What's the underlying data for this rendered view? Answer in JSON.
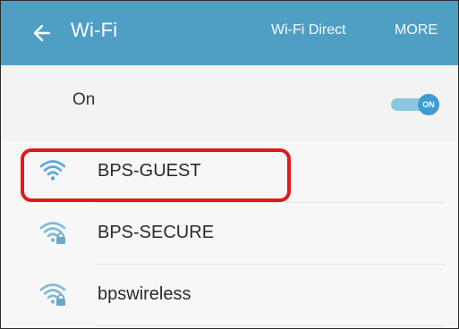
{
  "header": {
    "title": "Wi-Fi",
    "wifi_direct_label": "Wi-Fi Direct",
    "more_label": "MORE"
  },
  "toggle": {
    "label": "On",
    "switch_text": "ON",
    "state": "on"
  },
  "networks": [
    {
      "ssid": "BPS-GUEST",
      "secured": false,
      "highlighted": true
    },
    {
      "ssid": "BPS-SECURE",
      "secured": true,
      "highlighted": false
    },
    {
      "ssid": "bpswireless",
      "secured": true,
      "highlighted": false
    }
  ],
  "colors": {
    "appbar": "#4f9fc5",
    "highlight": "#e01a1a",
    "wifi_open": "#56a8d8",
    "wifi_secured": "#7fb9d6"
  }
}
